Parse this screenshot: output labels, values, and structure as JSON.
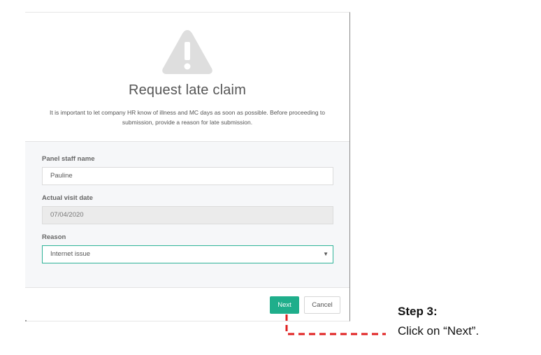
{
  "modal": {
    "title": "Request late claim",
    "description": "It is important to let company HR know of illness and MC days as soon as possible. Before proceeding to submission, provide a reason for late submission.",
    "icon": "warning-triangle-icon"
  },
  "form": {
    "staff_label": "Panel staff name",
    "staff_value": "Pauline",
    "date_label": "Actual visit date",
    "date_value": "07/04/2020",
    "reason_label": "Reason",
    "reason_value": "Internet issue"
  },
  "footer": {
    "next_label": "Next",
    "cancel_label": "Cancel"
  },
  "annotation": {
    "step_title": "Step 3:",
    "step_text": "Click on “Next”.",
    "color": "#e02020"
  },
  "colors": {
    "accent": "#1fae8b",
    "select_border": "#2eb398",
    "icon_gray": "#dedede"
  }
}
